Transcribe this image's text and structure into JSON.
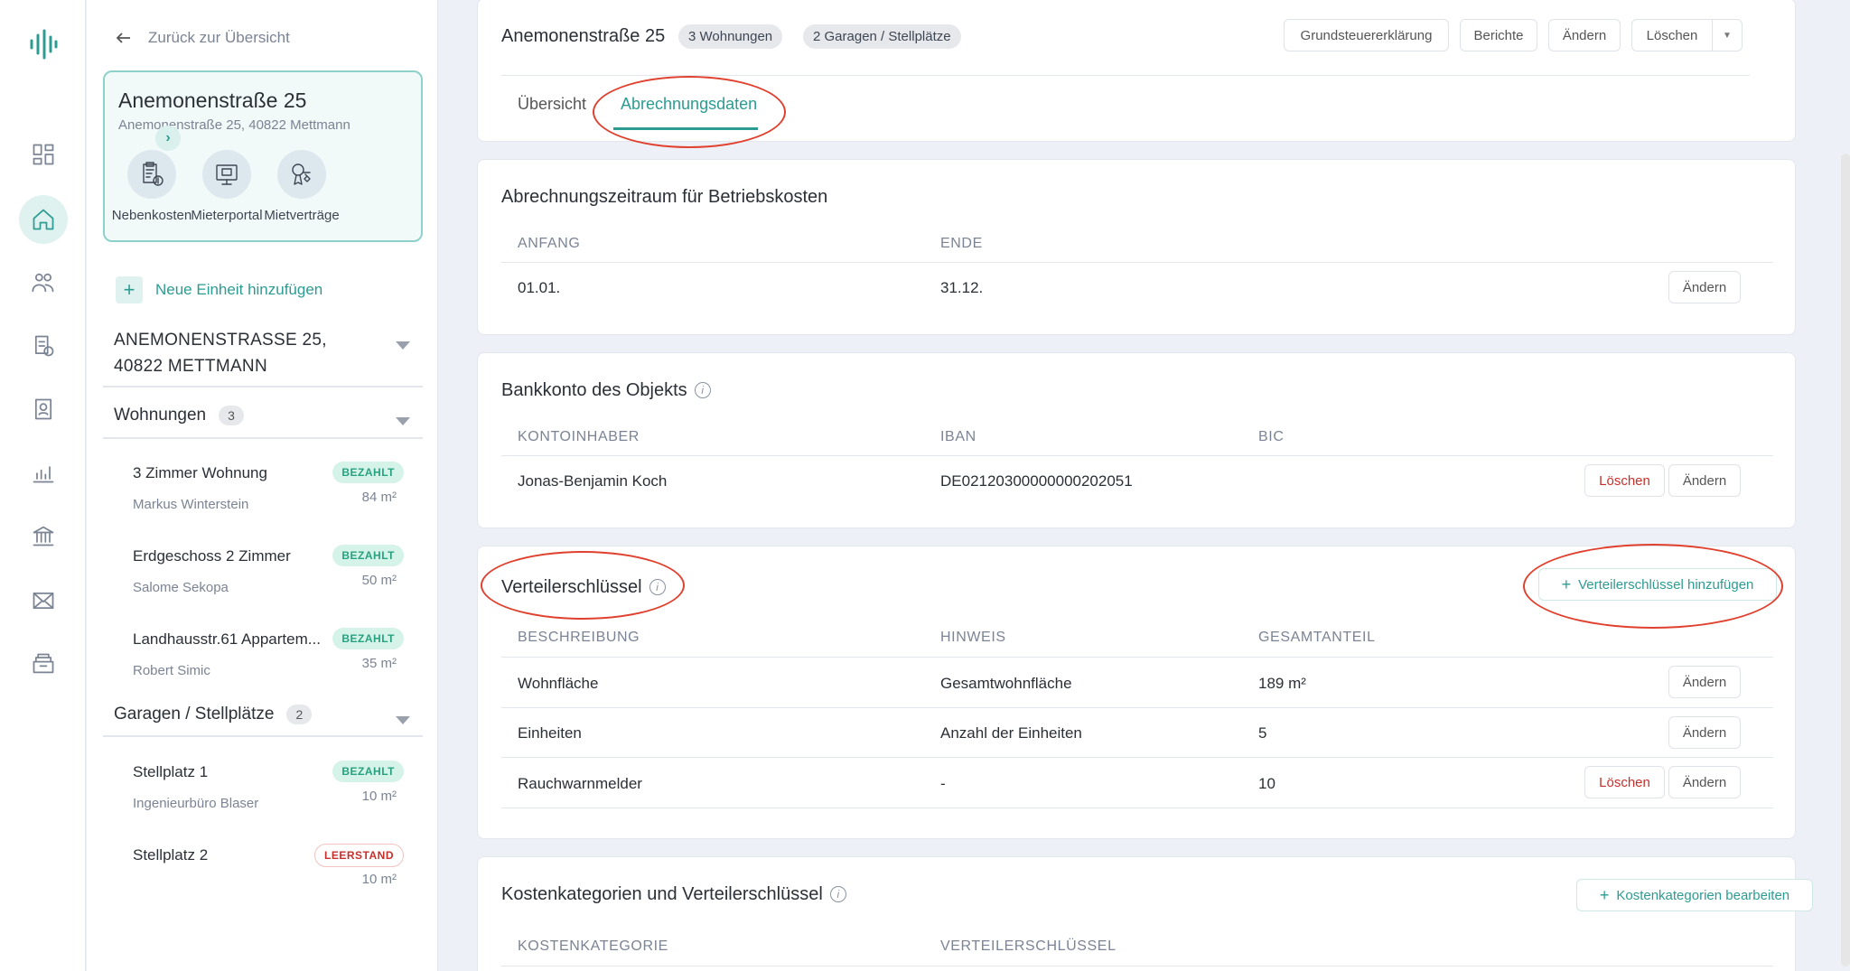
{
  "sidebar": {
    "back_label": "Zurück zur Übersicht",
    "property": {
      "title": "Anemonenstraße 25",
      "subtitle": "Anemonenstraße 25, 40822 Mettmann",
      "actions": [
        {
          "label": "Nebenkosten",
          "icon": "utility-bill-icon"
        },
        {
          "label": "Mieterportal",
          "icon": "tenant-portal-icon"
        },
        {
          "label": "Mietverträge",
          "icon": "lease-contract-icon"
        }
      ]
    },
    "add_unit_label": "Neue Einheit hinzufügen",
    "address_line1": "ANEMONENSTRASSE 25,",
    "address_line2": "40822 METTMANN",
    "groups": [
      {
        "label": "Wohnungen",
        "count": "3",
        "units": [
          {
            "name": "3 Zimmer Wohnung",
            "tenant": "Markus Winterstein",
            "status": "BEZAHLT",
            "area": "84 m²"
          },
          {
            "name": "Erdgeschoss 2 Zimmer",
            "tenant": "Salome Sekopa",
            "status": "BEZAHLT",
            "area": "50 m²"
          },
          {
            "name": "Landhausstr.61 Appartem...",
            "tenant": "Robert Simic",
            "status": "BEZAHLT",
            "area": "35 m²"
          }
        ]
      },
      {
        "label": "Garagen / Stellplätze",
        "count": "2",
        "units": [
          {
            "name": "Stellplatz 1",
            "tenant": "Ingenieurbüro Blaser",
            "status": "BEZAHLT",
            "area": "10 m²"
          },
          {
            "name": "Stellplatz 2",
            "tenant": "",
            "status": "LEERSTAND",
            "area": "10 m²"
          }
        ]
      }
    ]
  },
  "header": {
    "title": "Anemonenstraße 25",
    "pills": [
      "3 Wohnungen",
      "2 Garagen / Stellplätze"
    ],
    "buttons": {
      "tax": "Grundsteuererklärung",
      "reports": "Berichte",
      "edit": "Ändern",
      "delete": "Löschen"
    },
    "tabs": [
      "Übersicht",
      "Abrechnungsdaten"
    ]
  },
  "period": {
    "title": "Abrechnungszeitraum für Betriebskosten",
    "cols": [
      "ANFANG",
      "ENDE"
    ],
    "row": {
      "start": "01.01.",
      "end": "31.12."
    },
    "edit": "Ändern"
  },
  "bank": {
    "title": "Bankkonto des Objekts",
    "cols": [
      "KONTOINHABER",
      "IBAN",
      "BIC"
    ],
    "row": {
      "holder": "Jonas-Benjamin Koch",
      "iban": "DE02120300000000202051",
      "bic": ""
    },
    "delete": "Löschen",
    "edit": "Ändern"
  },
  "keys": {
    "title": "Verteilerschlüssel",
    "add": "Verteilerschlüssel hinzufügen",
    "cols": [
      "BESCHREIBUNG",
      "HINWEIS",
      "GESAMTANTEIL"
    ],
    "rows": [
      {
        "desc": "Wohnfläche",
        "hint": "Gesamtwohnfläche",
        "total": "189 m²"
      },
      {
        "desc": "Einheiten",
        "hint": "Anzahl der Einheiten",
        "total": "5"
      },
      {
        "desc": "Rauchwarnmelder",
        "hint": "-",
        "total": "10"
      }
    ],
    "delete": "Löschen",
    "edit": "Ändern"
  },
  "categories": {
    "title": "Kostenkategorien und Verteilerschlüssel",
    "edit": "Kostenkategorien bearbeiten",
    "cols": [
      "KOSTENKATEGORIE",
      "VERTEILERSCHLÜSSEL"
    ]
  },
  "colors": {
    "accent": "#2c9c92",
    "danger": "#c6302b",
    "highlight": "#e0412e"
  }
}
